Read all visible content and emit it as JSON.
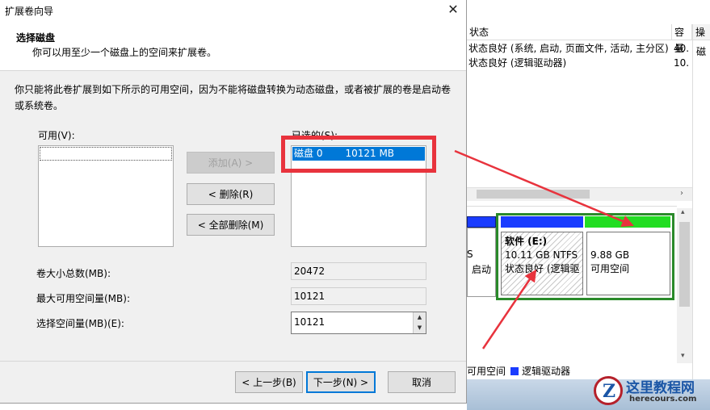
{
  "background_window": {
    "column_headers": [
      "状态",
      "容量",
      "操"
    ],
    "rows": [
      {
        "status": "状态良好 (系统, 启动, 页面文件, 活动, 主分区)",
        "capacity": "40."
      },
      {
        "status": "状态良好 (逻辑驱动器)",
        "capacity": "10."
      }
    ],
    "right_panel_item": "磁",
    "left_partition_fragment": {
      "line1": "S",
      "line2": "启动"
    },
    "partition_software": {
      "name": "软件 (E:)",
      "size": "10.11 GB NTFS",
      "status": "状态良好 (逻辑驱"
    },
    "partition_free": {
      "size": "9.88 GB",
      "label": "可用空间"
    },
    "legend": {
      "unallocated_label": "可用空间",
      "logical_label": "逻辑驱动器"
    },
    "colors": {
      "primary_bar": "#1a3cff",
      "free_bar": "#22dd22",
      "selection_border": "#2a8a2a"
    }
  },
  "dialog": {
    "title": "扩展卷向导",
    "header_title": "选择磁盘",
    "header_subtitle": "你可以用至少一个磁盘上的空间来扩展卷。",
    "description": "你只能将此卷扩展到如下所示的可用空间，因为不能将磁盘转换为动态磁盘，或者被扩展的卷是启动卷或系统卷。",
    "available_label": "可用(V):",
    "selected_label": "已选的(S):",
    "selected_items": [
      {
        "disk": "磁盘 0",
        "size": "10121 MB"
      }
    ],
    "buttons": {
      "add": "添加(A) >",
      "remove": "< 删除(R)",
      "remove_all": "< 全部删除(M)",
      "back": "< 上一步(B)",
      "next": "下一步(N) >",
      "cancel": "取消"
    },
    "fields": {
      "total_size_label": "卷大小总数(MB):",
      "total_size_value": "20472",
      "max_available_label": "最大可用空间量(MB):",
      "max_available_value": "10121",
      "select_amount_label": "选择空间量(MB)(E):",
      "select_amount_value": "10121"
    },
    "icons": {
      "close": "close-icon",
      "spin_up": "spin-up-icon",
      "spin_down": "spin-down-icon"
    },
    "accent_color": "#0078d7",
    "highlight_color": "#e8333d"
  },
  "watermark": {
    "logo_letter": "Z",
    "site_name_cn": "这里教程网",
    "site_domain": "herecours.com"
  }
}
